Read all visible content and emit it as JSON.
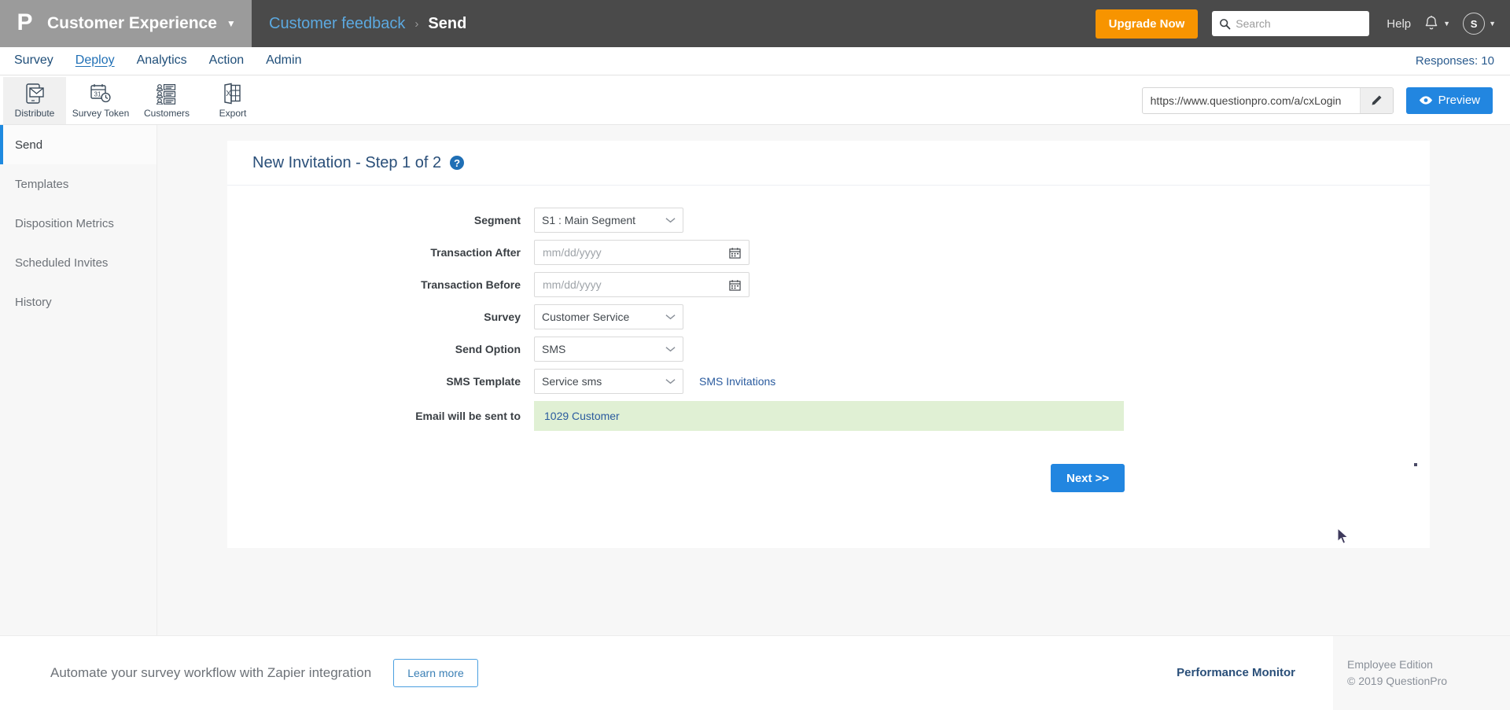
{
  "topbar": {
    "logo": "P",
    "brand_name": "Customer Experience",
    "brand_caret_icon": "caret-down-icon",
    "breadcrumb_link": "Customer feedback",
    "breadcrumb_separator": "›",
    "breadcrumb_current": "Send",
    "upgrade_label": "Upgrade Now",
    "search_placeholder": "Search",
    "search_value": "",
    "help_label": "Help",
    "bell_icon": "bell-icon",
    "avatar_initial": "S",
    "accent_orange": "#f79400",
    "bar_color": "#4a4a4a",
    "brand_block_color": "#9b9b9b"
  },
  "nav": {
    "items": [
      {
        "label": "Survey",
        "active": false
      },
      {
        "label": "Deploy",
        "active": true
      },
      {
        "label": "Analytics",
        "active": false
      },
      {
        "label": "Action",
        "active": false
      },
      {
        "label": "Admin",
        "active": false
      }
    ],
    "responses": "Responses: 10"
  },
  "toolbar": {
    "tools": [
      {
        "label": "Distribute",
        "icon": "phone-envelope-icon",
        "active": true
      },
      {
        "label": "Survey Token",
        "icon": "calendar-clock-icon",
        "active": false
      },
      {
        "label": "Customers",
        "icon": "customer-list-icon",
        "active": false
      },
      {
        "label": "Export",
        "icon": "excel-export-icon",
        "active": false
      }
    ],
    "url_value": "https://www.questionpro.com/a/cxLogin",
    "edit_icon": "pencil-icon",
    "preview_label": "Preview",
    "preview_icon": "eye-icon",
    "preview_color": "#2286e0"
  },
  "sidebar": {
    "items": [
      {
        "label": "Send",
        "active": true
      },
      {
        "label": "Templates",
        "active": false
      },
      {
        "label": "Disposition Metrics",
        "active": false
      },
      {
        "label": "Scheduled Invites",
        "active": false
      },
      {
        "label": "History",
        "active": false
      }
    ],
    "active_marker_color": "#1f8ae0"
  },
  "card": {
    "title": "New Invitation - Step 1 of 2",
    "help_icon": "help-circle-icon",
    "help_glyph": "?",
    "form": {
      "segment": {
        "label": "Segment",
        "value": "S1 : Main Segment",
        "caret_icon": "chevron-down-icon"
      },
      "transaction_after": {
        "label": "Transaction After",
        "value": "",
        "placeholder": "mm/dd/yyyy",
        "calendar_icon": "calendar-icon"
      },
      "transaction_before": {
        "label": "Transaction Before",
        "value": "",
        "placeholder": "mm/dd/yyyy",
        "calendar_icon": "calendar-icon"
      },
      "survey": {
        "label": "Survey",
        "value": "Customer Service",
        "caret_icon": "chevron-down-icon"
      },
      "send_option": {
        "label": "Send Option",
        "value": "SMS",
        "caret_icon": "chevron-down-icon"
      },
      "sms_template": {
        "label": "SMS Template",
        "value": "Service sms",
        "caret_icon": "chevron-down-icon",
        "side_link": "SMS Invitations"
      },
      "recipients": {
        "label": "Email will be sent to",
        "value": "1029 Customer",
        "highlight_color": "#e0f0d4"
      }
    },
    "next_label": "Next >>"
  },
  "footer": {
    "zapier_text": "Automate your survey workflow with Zapier integration",
    "learn_more_label": "Learn more",
    "performance_monitor_label": "Performance Monitor",
    "edition": "Employee Edition",
    "copyright": "© 2019 QuestionPro"
  }
}
